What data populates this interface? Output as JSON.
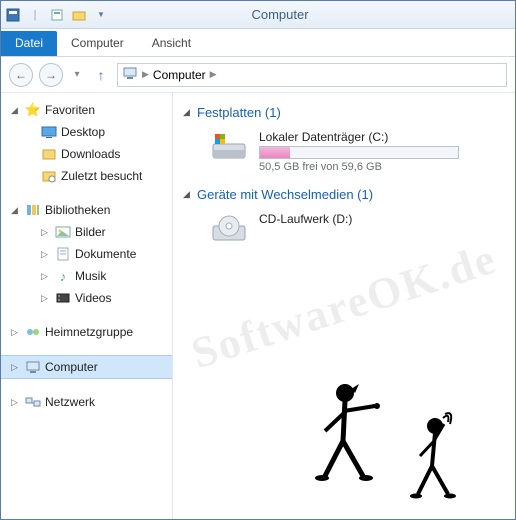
{
  "title": "Computer",
  "ribbon": {
    "file": "Datei",
    "computer": "Computer",
    "view": "Ansicht"
  },
  "breadcrumb": {
    "item": "Computer"
  },
  "sidebar": {
    "favorites": "Favoriten",
    "desktop": "Desktop",
    "downloads": "Downloads",
    "recent": "Zuletzt besucht",
    "libraries": "Bibliotheken",
    "pictures": "Bilder",
    "documents": "Dokumente",
    "music": "Musik",
    "videos": "Videos",
    "homegroup": "Heimnetzgruppe",
    "computer": "Computer",
    "network": "Netzwerk"
  },
  "content": {
    "hdd_header": "Festplatten (1)",
    "local_disk": "Lokaler Datenträger (C:)",
    "local_disk_sub": "50,5 GB frei von 59,6 GB",
    "removable_header": "Geräte mit Wechselmedien (1)",
    "cd_drive": "CD-Laufwerk (D:)"
  },
  "watermark": "SoftwareOK.de"
}
